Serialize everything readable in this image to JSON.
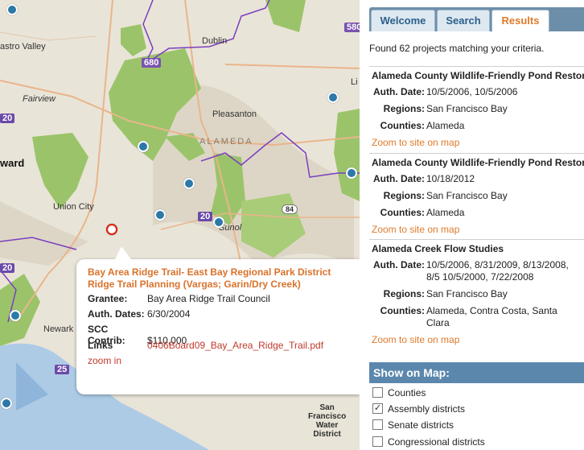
{
  "map": {
    "places": {
      "dublin": "Dublin",
      "castro_valley": "astro Valley",
      "fairview": "Fairview",
      "hayward": "ward",
      "pleasanton": "Pleasanton",
      "alameda": "ALAMEDA",
      "union_city": "Union City",
      "sunol": "Sunol",
      "newark": "Newark",
      "li": "Li",
      "water": [
        "San",
        "Francisco",
        "Water",
        "District"
      ]
    },
    "shields": {
      "i680": "680",
      "i580": "580",
      "r20a": "20",
      "r20b": "20",
      "r20c": "20",
      "r25": "25",
      "r84": "84"
    },
    "colors": {
      "land": "#e9e4d8",
      "park": "#9bc46a",
      "water": "#aecbe6",
      "boundary": "#7b3fbf",
      "road": "#e9b58a"
    }
  },
  "popup": {
    "title": "Bay Area Ridge Trail- East Bay Regional Park District Ridge Trail Planning (Vargas; Garin/Dry Creek)",
    "grantee_label": "Grantee:",
    "grantee": "Bay Area Ridge Trail Council",
    "auth_label": "Auth. Dates:",
    "auth": "6/30/2004",
    "scc_label": "SCC Contrib:",
    "scc": "$110,000",
    "links_label": "Links",
    "link": "0406Board09_Bay_Area_Ridge_Trail.pdf",
    "zoom": "zoom in"
  },
  "panel": {
    "tabs": {
      "welcome": "Welcome",
      "search": "Search",
      "results": "Results"
    },
    "found": "Found 62 projects matching your criteria.",
    "labels": {
      "auth": "Auth. Date:",
      "regions": "Regions:",
      "counties": "Counties:"
    },
    "results": [
      {
        "title": "Alameda County Wildlife-Friendly Pond Restora",
        "auth": "10/5/2006, 10/5/2006",
        "regions": "San Francisco Bay",
        "counties": "Alameda",
        "zoom": "Zoom to site on map"
      },
      {
        "title": "Alameda County Wildlife-Friendly Pond Restora",
        "auth": "10/18/2012",
        "regions": "San Francisco Bay",
        "counties": "Alameda",
        "zoom": "Zoom to site on map"
      },
      {
        "title": "Alameda Creek Flow Studies",
        "auth": "10/5/2006, 8/31/2009, 8/13/2008, 8/5 10/5/2000, 7/22/2008",
        "regions": "San Francisco Bay",
        "counties": "Alameda, Contra Costa, Santa Clara",
        "zoom": "Zoom to site on map"
      }
    ],
    "show_on_map": "Show on Map:",
    "options": [
      {
        "label": "Counties",
        "checked": false
      },
      {
        "label": "Assembly districts",
        "checked": true
      },
      {
        "label": "Senate districts",
        "checked": false
      },
      {
        "label": "Congressional districts",
        "checked": false
      }
    ]
  }
}
